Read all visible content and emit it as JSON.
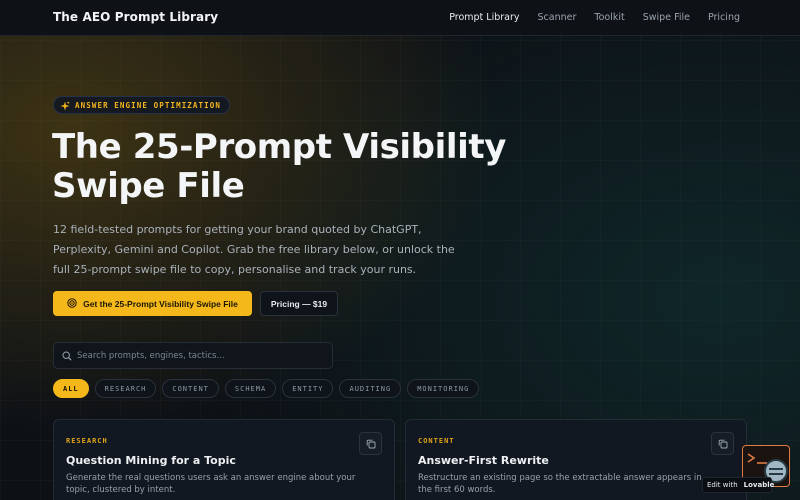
{
  "nav": {
    "brand": "The AEO Prompt Library",
    "links": [
      {
        "label": "Prompt Library",
        "active": true
      },
      {
        "label": "Scanner",
        "active": false
      },
      {
        "label": "Toolkit",
        "active": false
      },
      {
        "label": "Swipe File",
        "active": false
      },
      {
        "label": "Pricing",
        "active": false
      }
    ]
  },
  "hero": {
    "badge": "ANSWER ENGINE OPTIMIZATION",
    "title_line1": "The 25-Prompt Visibility",
    "title_line2": "Swipe File",
    "subtitle": "12 field-tested prompts for getting your brand quoted by ChatGPT, Perplexity, Gemini and Copilot. Grab the free library below, or unlock the full 25-prompt swipe file to copy, personalise and track your runs.",
    "cta_primary": "Get the 25-Prompt Visibility Swipe File",
    "cta_secondary": "Pricing — $19"
  },
  "search": {
    "placeholder": "Search prompts, engines, tactics...",
    "value": ""
  },
  "filters": [
    {
      "label": "ALL",
      "active": true
    },
    {
      "label": "RESEARCH",
      "active": false
    },
    {
      "label": "CONTENT",
      "active": false
    },
    {
      "label": "SCHEMA",
      "active": false
    },
    {
      "label": "ENTITY",
      "active": false
    },
    {
      "label": "AUDITING",
      "active": false
    },
    {
      "label": "MONITORING",
      "active": false
    }
  ],
  "cards": [
    {
      "category": "RESEARCH",
      "title": "Question Mining for a Topic",
      "description": "Generate the real questions users ask an answer engine about your topic, clustered by intent."
    },
    {
      "category": "CONTENT",
      "title": "Answer-First Rewrite",
      "description": "Restructure an existing page so the extractable answer appears in the first 60 words."
    }
  ],
  "lovable": {
    "prefix": "Edit with",
    "brand": "Lovable"
  },
  "colors": {
    "accent": "#f5b81a",
    "background": "#0d1116",
    "card": "#121821"
  },
  "icons": {
    "badge": "sparkle-icon",
    "cta": "target-icon",
    "search": "search-icon",
    "copy": "copy-icon"
  }
}
